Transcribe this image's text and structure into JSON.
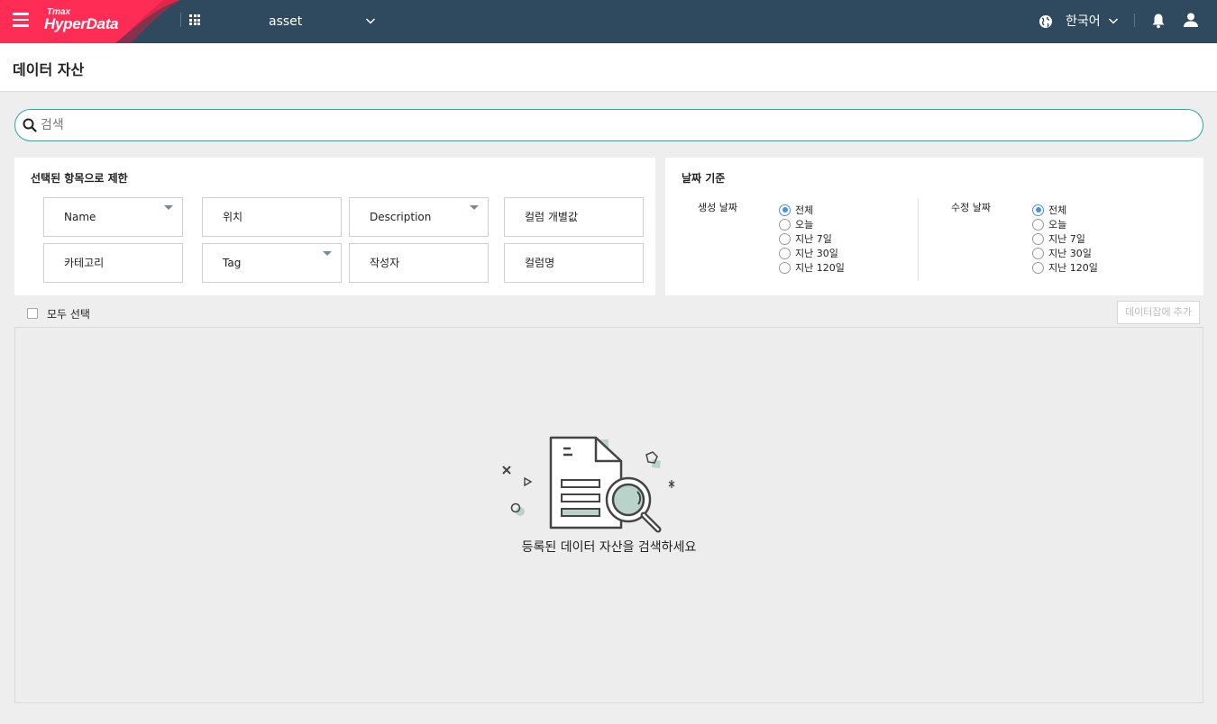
{
  "topbar": {
    "logo_small": "Tmax",
    "logo_big": "HyperData",
    "app_selected": "asset",
    "language": "한국어",
    "brand_color": "#ff2d55",
    "bar_color": "#2f4a5e"
  },
  "page": {
    "title": "데이터 자산"
  },
  "search": {
    "placeholder": "검색",
    "value": ""
  },
  "filters": {
    "title": "선택된 항목으로 제한",
    "buttons": [
      {
        "label": "Name",
        "dropdown": true
      },
      {
        "label": "위치",
        "dropdown": false
      },
      {
        "label": "Description",
        "dropdown": true
      },
      {
        "label": "컬럼 개별값",
        "dropdown": false
      },
      {
        "label": "카테고리",
        "dropdown": false
      },
      {
        "label": "Tag",
        "dropdown": true
      },
      {
        "label": "작성자",
        "dropdown": false
      },
      {
        "label": "컬럼명",
        "dropdown": false
      }
    ]
  },
  "date_filter": {
    "title": "날짜 기준",
    "created": {
      "label": "생성 날짜",
      "options": [
        "전체",
        "오늘",
        "지난 7일",
        "지난 30일",
        "지난 120일"
      ],
      "selected": "전체"
    },
    "modified": {
      "label": "수정 날짜",
      "options": [
        "전체",
        "오늘",
        "지난 7일",
        "지난 30일",
        "지난 120일"
      ],
      "selected": "전체"
    }
  },
  "toolbar": {
    "select_all": "모두 선택",
    "add_button": "데이터잡에 추가"
  },
  "results": {
    "empty_message": "등록된 데이터 자산을 검색하세요"
  }
}
